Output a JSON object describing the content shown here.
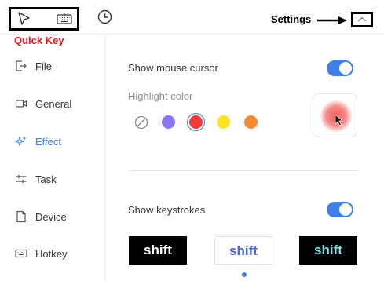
{
  "annotations": {
    "settings_label": "Settings",
    "quick_key_label": "Quick Key"
  },
  "toolbar": {
    "icons": [
      "cursor-icon",
      "keyboard-icon",
      "history-icon",
      "collapse-chevron-icon"
    ]
  },
  "sidebar": {
    "items": [
      {
        "label": "File",
        "icon": "file-export-icon",
        "active": false
      },
      {
        "label": "General",
        "icon": "video-camera-icon",
        "active": false
      },
      {
        "label": "Effect",
        "icon": "sparkle-icon",
        "active": true
      },
      {
        "label": "Task",
        "icon": "task-sliders-icon",
        "active": false
      },
      {
        "label": "Device",
        "icon": "device-icon",
        "active": false
      },
      {
        "label": "Hotkey",
        "icon": "keyboard-icon",
        "active": false
      }
    ]
  },
  "effect": {
    "show_mouse_cursor": {
      "label": "Show mouse cursor",
      "enabled": true
    },
    "highlight_color": {
      "label": "Highlight color",
      "options": [
        "none",
        "#8c74f4",
        "#f23b3b",
        "#fbe32b",
        "#f5892d"
      ],
      "selected": "#f23b3b"
    },
    "show_keystrokes": {
      "label": "Show keystrokes",
      "enabled": true
    },
    "keystroke_styles": [
      {
        "text": "shift",
        "style": "dark"
      },
      {
        "text": "shift",
        "style": "light"
      },
      {
        "text": "shift",
        "style": "dark-teal"
      }
    ],
    "keystroke_page_index": 1
  },
  "colors": {
    "accent": "#3d7ee8",
    "annotation_red": "#e3141b"
  }
}
